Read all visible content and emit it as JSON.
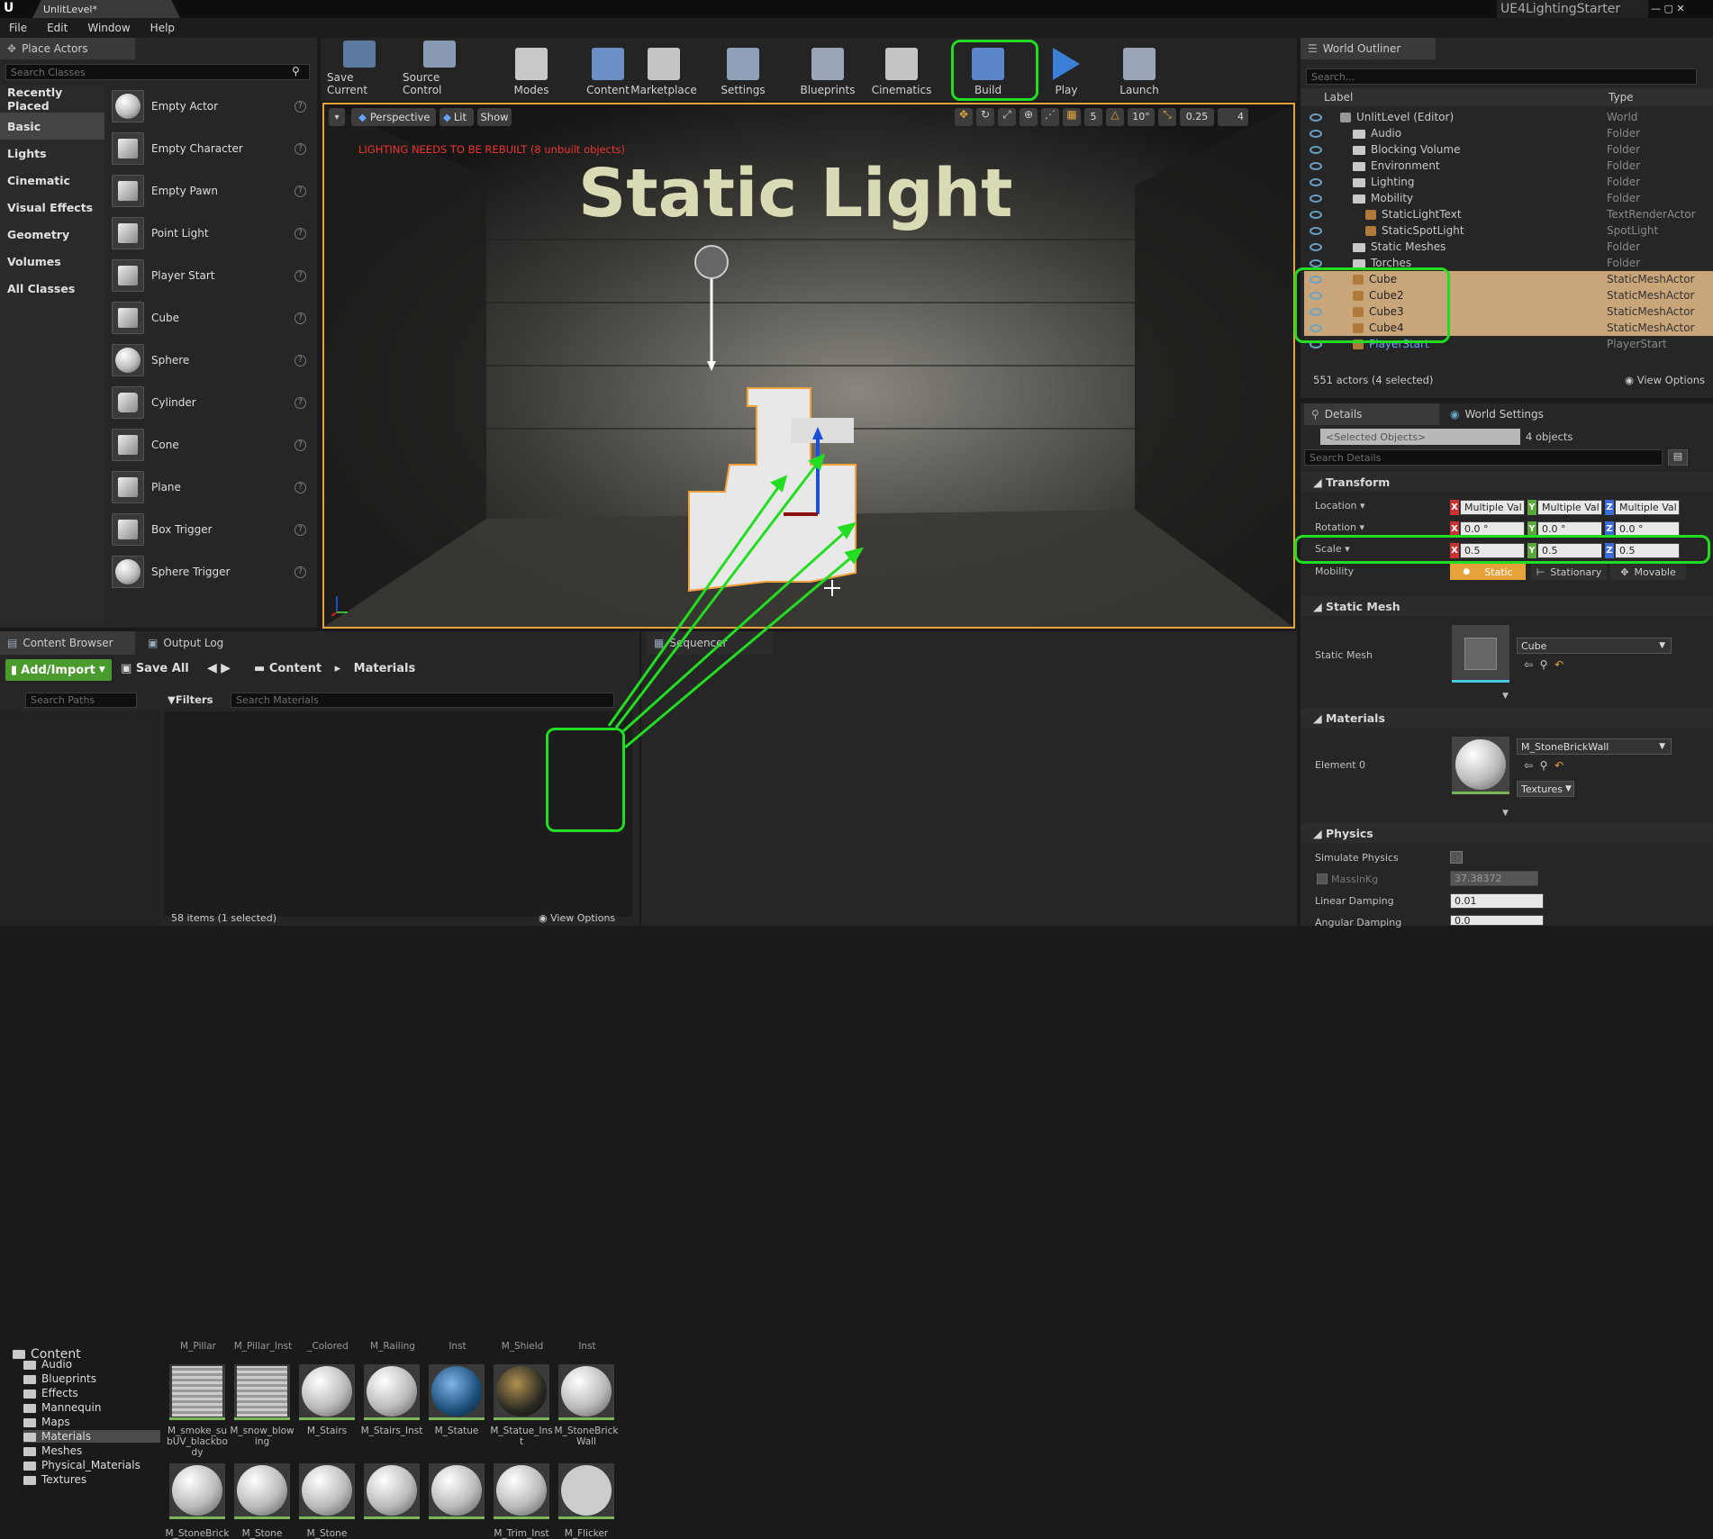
{
  "app": {
    "tab_title": "UnlitLevel*",
    "project": "UE4LightingStarter"
  },
  "menu": [
    "File",
    "Edit",
    "Window",
    "Help"
  ],
  "place_actors": {
    "title": "Place Actors",
    "search_placeholder": "Search Classes",
    "categories": [
      "Recently Placed",
      "Basic",
      "Lights",
      "Cinematic",
      "Visual Effects",
      "Geometry",
      "Volumes",
      "All Classes"
    ],
    "selected_category": "Basic",
    "items": [
      "Empty Actor",
      "Empty Character",
      "Empty Pawn",
      "Point Light",
      "Player Start",
      "Cube",
      "Sphere",
      "Cylinder",
      "Cone",
      "Plane",
      "Box Trigger",
      "Sphere Trigger"
    ]
  },
  "toolbar": {
    "buttons": [
      "Save Current",
      "Source Control",
      "Modes",
      "Content",
      "Marketplace",
      "Settings",
      "Blueprints",
      "Cinematics",
      "Build",
      "Play",
      "Launch"
    ]
  },
  "viewport": {
    "perspective": "Perspective",
    "lit": "Lit",
    "show": "Show",
    "warning": "LIGHTING NEEDS TO BE REBUILT (8 unbuilt objects)",
    "text_render": "Static Light",
    "snap_grid": "5",
    "snap_rot": "10°",
    "snap_scale": "0.25",
    "cam_speed": "4"
  },
  "outliner": {
    "title": "World Outliner",
    "search_placeholder": "Search...",
    "col_label": "Label",
    "col_type": "Type",
    "rows": [
      {
        "label": "UnlitLevel (Editor)",
        "type": "World",
        "indent": 0
      },
      {
        "label": "Audio",
        "type": "Folder",
        "indent": 1
      },
      {
        "label": "Blocking Volume",
        "type": "Folder",
        "indent": 1
      },
      {
        "label": "Environment",
        "type": "Folder",
        "indent": 1
      },
      {
        "label": "Lighting",
        "type": "Folder",
        "indent": 1
      },
      {
        "label": "Mobility",
        "type": "Folder",
        "indent": 1
      },
      {
        "label": "StaticLightText",
        "type": "TextRenderActor",
        "indent": 2
      },
      {
        "label": "StaticSpotLight",
        "type": "SpotLight",
        "indent": 2
      },
      {
        "label": "Static Meshes",
        "type": "Folder",
        "indent": 1
      },
      {
        "label": "Torches",
        "type": "Folder",
        "indent": 1
      },
      {
        "label": "Cube",
        "type": "StaticMeshActor",
        "indent": 1
      },
      {
        "label": "Cube2",
        "type": "StaticMeshActor",
        "indent": 1
      },
      {
        "label": "Cube3",
        "type": "StaticMeshActor",
        "indent": 1
      },
      {
        "label": "Cube4",
        "type": "StaticMeshActor",
        "indent": 1
      },
      {
        "label": "PlayerStart",
        "type": "PlayerStart",
        "indent": 1
      }
    ],
    "status": "551 actors (4 selected)",
    "view_options": "View Options"
  },
  "details": {
    "tab": "Details",
    "tab2": "World Settings",
    "selected_objects": "<Selected Objects>",
    "objects_count": "4 objects",
    "search_placeholder": "Search Details",
    "transform": "Transform",
    "location": "Location",
    "rotation": "Rotation",
    "scale": "Scale",
    "mobility": "Mobility",
    "loc": [
      "Multiple Val",
      "Multiple Val",
      "Multiple Val"
    ],
    "rot": [
      "0.0 °",
      "0.0 °",
      "0.0 °"
    ],
    "scl": [
      "0.5",
      "0.5",
      "0.5"
    ],
    "mob": [
      "Static",
      "Stationary",
      "Movable"
    ],
    "static_mesh_section": "Static Mesh",
    "static_mesh_label": "Static Mesh",
    "static_mesh_value": "Cube",
    "materials_section": "Materials",
    "element0": "Element 0",
    "material_value": "M_StoneBrickWall",
    "textures": "Textures",
    "physics_section": "Physics",
    "simulate_physics": "Simulate Physics",
    "mass": "MassInKg",
    "mass_value": "37.38372",
    "linear_damping": "Linear Damping",
    "linear_damping_value": "0.01",
    "angular_damping": "Angular Damping",
    "angular_damping_value": "0.0"
  },
  "content_browser": {
    "tab": "Content Browser",
    "tab2": "Output Log",
    "tab3": "Sequencer",
    "add_import": "Add/Import",
    "save_all": "Save All",
    "crumb1": "Content",
    "crumb2": "Materials",
    "search_paths": "Search Paths",
    "filters": "Filters",
    "search_materials": "Search Materials",
    "tree": [
      "Content",
      "Audio",
      "Blueprints",
      "Effects",
      "Mannequin",
      "Maps",
      "Materials",
      "Meshes",
      "Physical_Materials",
      "Textures"
    ],
    "top_labels": [
      "M_Pillar",
      "M_Pillar_Inst",
      "_Colored",
      "M_Railing",
      "Inst",
      "M_Shield",
      "Inst"
    ],
    "assets": [
      {
        "name": "M_smoke_subUV_blackbody"
      },
      {
        "name": "M_snow_blowing"
      },
      {
        "name": "M_Stairs"
      },
      {
        "name": "M_Stairs_Inst"
      },
      {
        "name": "M_Statue"
      },
      {
        "name": "M_Statue_Inst"
      },
      {
        "name": "M_StoneBrickWall"
      }
    ],
    "row2_labels": [
      "M_StoneBrick",
      "M_Stone",
      "M_Stone",
      "",
      "",
      "M_Trim_Inst",
      "M_Flicker"
    ],
    "status": "58 items (1 selected)",
    "view_options": "View Options"
  }
}
